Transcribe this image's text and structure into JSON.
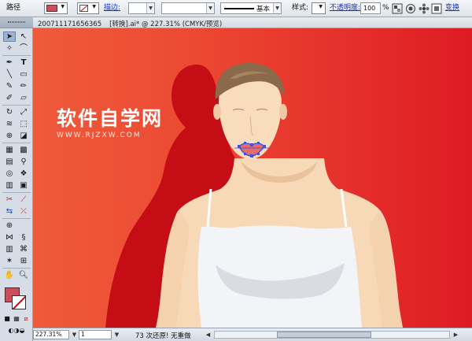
{
  "control_bar": {
    "object_type": "路径",
    "fill_color": "#c9505a",
    "stroke_label": "描边:",
    "stroke_weight": "",
    "brush_preset": "",
    "stroke_profile": "基本",
    "style_label": "样式:",
    "opacity_label": "不透明度:",
    "opacity_value": "100",
    "opacity_unit": "%",
    "transform_link": "变换"
  },
  "document": {
    "tab_title_prefix": "200711171656365",
    "tab_title_main": "[转换].ai* @ 227.31% (CMYK/预览)"
  },
  "watermark": {
    "main": "软件自学网",
    "url": "WWW.RJZXW.COM"
  },
  "status_bar": {
    "zoom": "227.31%",
    "page": "1",
    "message": "73 次还原! 无重做"
  },
  "colors": {
    "accent_fill": "#c9505a",
    "background_red": "#e42d2a",
    "shadow_red": "#c40d15",
    "selection_blue": "#3b52e6"
  }
}
